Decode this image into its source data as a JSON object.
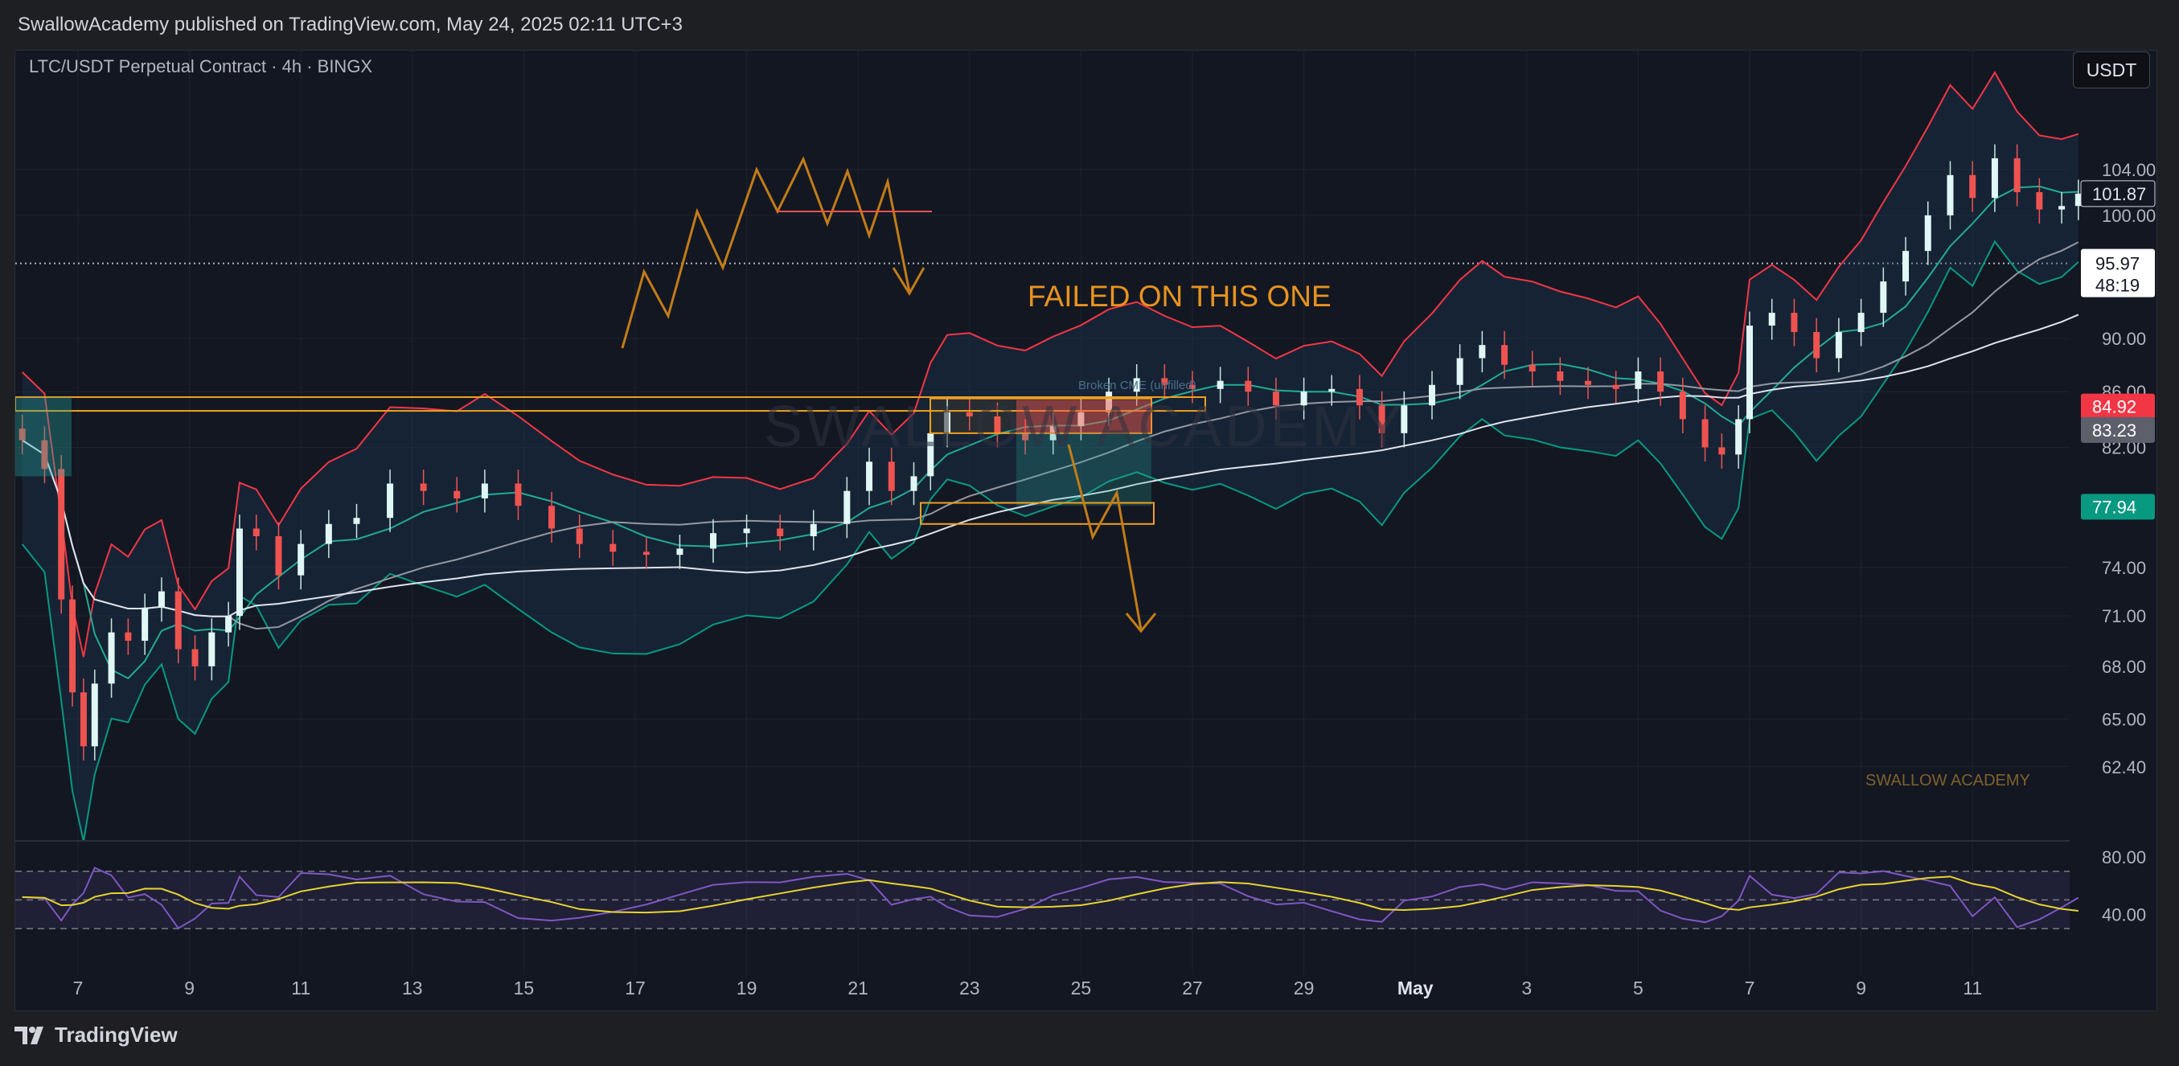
{
  "header": {
    "published_text": "SwallowAcademy published on TradingView.com, May 24, 2025 02:11 UTC+3"
  },
  "symbol": {
    "title": "LTC/USDT Perpetual Contract · 4h · BINGX"
  },
  "currency_button": "USDT",
  "annotation": "FAILED ON THIS ONE",
  "watermark_small": "SWALLOW ACADEMY",
  "watermark_large": "SWALLOW ACADEMY",
  "broken_label": "Broken CME (unfilled)",
  "footer": {
    "brand": "TradingView"
  },
  "price_tags": {
    "current": "101.87",
    "countdown_price": "95.97",
    "countdown_time": "48:19",
    "red": "84.92",
    "gray": "83.23",
    "green": "77.94"
  },
  "colors": {
    "bull": "#26a69a",
    "bear": "#ef5350",
    "annotation": "#e8931e",
    "rsi_ma": "#e6d430",
    "rsi": "#7e57c2"
  },
  "chart_data": {
    "type": "candlestick",
    "title": "LTC/USDT Perpetual Contract · 4h · BINGX",
    "price_axis": {
      "labels": [
        "104.00",
        "100.00",
        "90.00",
        "86.00",
        "82.00",
        "74.00",
        "71.00",
        "68.00",
        "65.00",
        "62.40"
      ],
      "scale": "log"
    },
    "x_ticks": [
      "7",
      "9",
      "11",
      "13",
      "15",
      "17",
      "19",
      "21",
      "23",
      "25",
      "27",
      "29",
      "May",
      "3",
      "5",
      "7",
      "9",
      "11"
    ],
    "rsi_axis": {
      "labels": [
        "80.00",
        "40.00"
      ],
      "bands": [
        70,
        50,
        30
      ]
    },
    "ylim": [
      59.5,
      112
    ],
    "series_close": [
      {
        "d": 6.0,
        "v": 82.5
      },
      {
        "d": 6.4,
        "v": 80.5
      },
      {
        "d": 6.7,
        "v": 72
      },
      {
        "d": 6.9,
        "v": 66.5
      },
      {
        "d": 7.1,
        "v": 63.5
      },
      {
        "d": 7.3,
        "v": 67
      },
      {
        "d": 7.6,
        "v": 70
      },
      {
        "d": 7.9,
        "v": 69.5
      },
      {
        "d": 8.2,
        "v": 71.5
      },
      {
        "d": 8.5,
        "v": 72.5
      },
      {
        "d": 8.8,
        "v": 69
      },
      {
        "d": 9.1,
        "v": 68
      },
      {
        "d": 9.4,
        "v": 70
      },
      {
        "d": 9.7,
        "v": 71
      },
      {
        "d": 9.9,
        "v": 76.5
      },
      {
        "d": 10.2,
        "v": 76
      },
      {
        "d": 10.6,
        "v": 73.5
      },
      {
        "d": 11.0,
        "v": 75.5
      },
      {
        "d": 11.5,
        "v": 76.8
      },
      {
        "d": 12.0,
        "v": 77.2
      },
      {
        "d": 12.6,
        "v": 79.5
      },
      {
        "d": 13.2,
        "v": 79
      },
      {
        "d": 13.8,
        "v": 78.5
      },
      {
        "d": 14.3,
        "v": 79.5
      },
      {
        "d": 14.9,
        "v": 78
      },
      {
        "d": 15.5,
        "v": 76.5
      },
      {
        "d": 16.0,
        "v": 75.5
      },
      {
        "d": 16.6,
        "v": 75
      },
      {
        "d": 17.2,
        "v": 74.8
      },
      {
        "d": 17.8,
        "v": 75.2
      },
      {
        "d": 18.4,
        "v": 76.2
      },
      {
        "d": 19.0,
        "v": 76.5
      },
      {
        "d": 19.6,
        "v": 76
      },
      {
        "d": 20.2,
        "v": 76.8
      },
      {
        "d": 20.8,
        "v": 79
      },
      {
        "d": 21.2,
        "v": 81
      },
      {
        "d": 21.6,
        "v": 79
      },
      {
        "d": 22.0,
        "v": 80
      },
      {
        "d": 22.3,
        "v": 83
      },
      {
        "d": 22.6,
        "v": 84.5
      },
      {
        "d": 23.0,
        "v": 84.2
      },
      {
        "d": 23.5,
        "v": 83
      },
      {
        "d": 24.0,
        "v": 82.5
      },
      {
        "d": 24.5,
        "v": 83.5
      },
      {
        "d": 25.0,
        "v": 84.5
      },
      {
        "d": 25.5,
        "v": 86
      },
      {
        "d": 26.0,
        "v": 87
      },
      {
        "d": 26.5,
        "v": 86.5
      },
      {
        "d": 27.0,
        "v": 86.2
      },
      {
        "d": 27.5,
        "v": 86.8
      },
      {
        "d": 28.0,
        "v": 86
      },
      {
        "d": 28.5,
        "v": 85
      },
      {
        "d": 29.0,
        "v": 86
      },
      {
        "d": 29.5,
        "v": 86.2
      },
      {
        "d": 30.0,
        "v": 85
      },
      {
        "d": 30.4,
        "v": 83
      },
      {
        "d": 30.8,
        "v": 85
      },
      {
        "d": 31.3,
        "v": 86.5
      },
      {
        "d": 31.8,
        "v": 88.5
      },
      {
        "d": 32.2,
        "v": 89.5
      },
      {
        "d": 32.6,
        "v": 88
      },
      {
        "d": 33.1,
        "v": 87.5
      },
      {
        "d": 33.6,
        "v": 86.8
      },
      {
        "d": 34.1,
        "v": 86.5
      },
      {
        "d": 34.6,
        "v": 86.2
      },
      {
        "d": 35.0,
        "v": 87.5
      },
      {
        "d": 35.4,
        "v": 86
      },
      {
        "d": 35.8,
        "v": 84
      },
      {
        "d": 36.2,
        "v": 82
      },
      {
        "d": 36.5,
        "v": 81.5
      },
      {
        "d": 36.8,
        "v": 84
      },
      {
        "d": 37.0,
        "v": 91
      },
      {
        "d": 37.4,
        "v": 92
      },
      {
        "d": 37.8,
        "v": 90.5
      },
      {
        "d": 38.2,
        "v": 88.5
      },
      {
        "d": 38.6,
        "v": 90.5
      },
      {
        "d": 39.0,
        "v": 92
      },
      {
        "d": 39.4,
        "v": 94.5
      },
      {
        "d": 39.8,
        "v": 97
      },
      {
        "d": 40.2,
        "v": 100
      },
      {
        "d": 40.6,
        "v": 103.5
      },
      {
        "d": 41.0,
        "v": 101.5
      },
      {
        "d": 41.4,
        "v": 105
      },
      {
        "d": 41.8,
        "v": 102
      },
      {
        "d": 42.2,
        "v": 100.5
      },
      {
        "d": 42.6,
        "v": 100.8
      },
      {
        "d": 42.9,
        "v": 101.87
      }
    ]
  }
}
